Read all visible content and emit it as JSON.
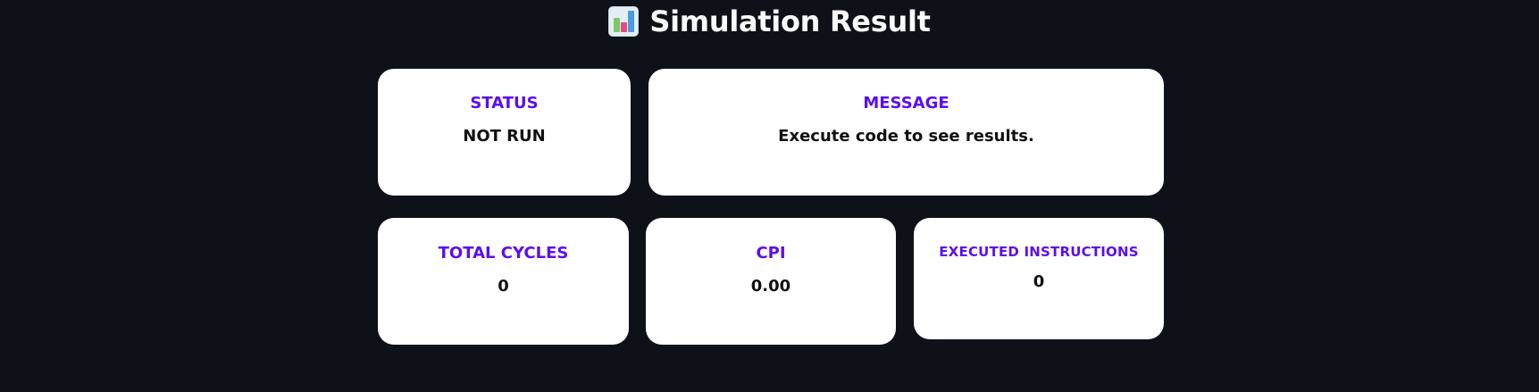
{
  "header": {
    "icon": "bar-chart-emoji",
    "title": "Simulation Result"
  },
  "cards": {
    "status": {
      "label": "STATUS",
      "value": "NOT RUN"
    },
    "message": {
      "label": "MESSAGE",
      "value": "Execute code to see results."
    },
    "total_cycles": {
      "label": "TOTAL CYCLES",
      "value": "0"
    },
    "cpi": {
      "label": "CPI",
      "value": "0.00"
    },
    "executed_instructions": {
      "label": "EXECUTED INSTRUCTIONS",
      "value": "0"
    }
  },
  "colors": {
    "background": "#0e1117",
    "card_background": "#ffffff",
    "label_accent": "#5b0ef0",
    "value_text": "#111111"
  }
}
